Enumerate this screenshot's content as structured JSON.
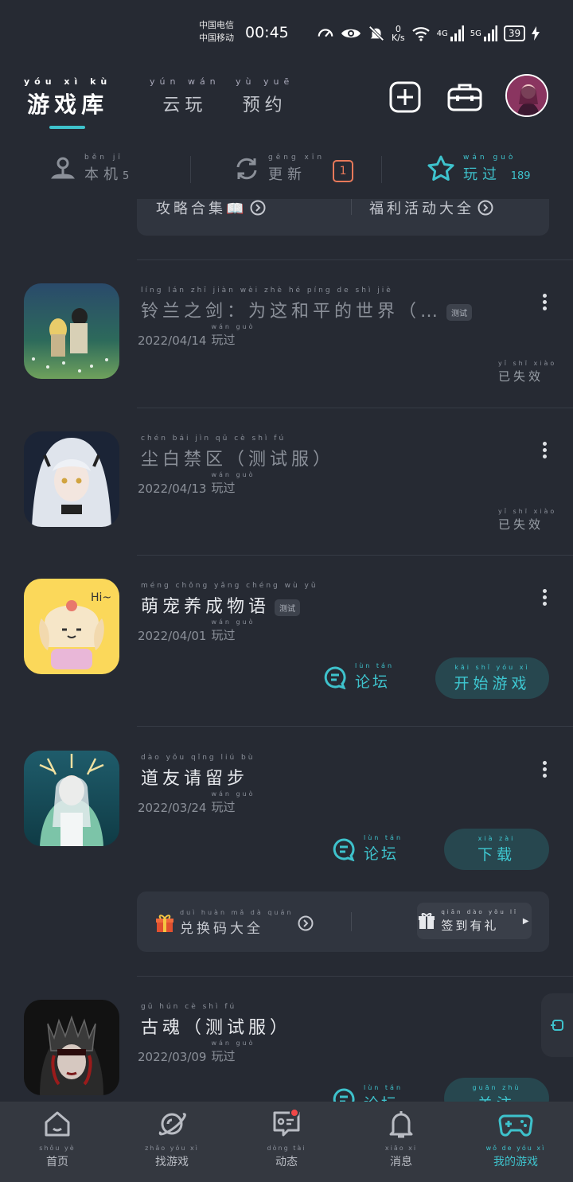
{
  "status_bar": {
    "carrier_1": "中国电信",
    "carrier_2": "中国移动",
    "time": "00:45",
    "speed_value": "0",
    "speed_unit": "K/s",
    "network_1": "4G",
    "network_2": "5G",
    "battery": "39"
  },
  "header": {
    "tabs": [
      {
        "pinyin": "yóu xì kù",
        "label": "游戏库",
        "active": true
      },
      {
        "pinyin": "yún wán",
        "label": "云玩",
        "active": false
      },
      {
        "pinyin": "yù yuē",
        "label": "预约",
        "active": false
      }
    ]
  },
  "subtabs": {
    "local": {
      "pinyin": "běn jī",
      "label": "本机",
      "count": "5"
    },
    "update": {
      "pinyin": "gēng xīn",
      "label": "更新",
      "count": "1"
    },
    "played": {
      "pinyin": "wán guò",
      "label": "玩过",
      "count": "189"
    }
  },
  "top_bar": {
    "left": "攻略合集📖",
    "right": "福利活动大全"
  },
  "games": [
    {
      "title": "铃兰之剑：为这和平的世界（…",
      "title_pinyin": "líng lán zhī jiàn   wèi zhè hé píng de shì jiè",
      "tag": "测试",
      "date": "2022/04/14",
      "played_pinyin": "wán guò",
      "played": "玩过",
      "status_pinyin": "yǐ shī xiào",
      "status": "已失效"
    },
    {
      "title": "尘白禁区（测试服）",
      "title_pinyin": "chén bái jìn qū   cè shì fú",
      "date": "2022/04/13",
      "played_pinyin": "wán guò",
      "played": "玩过",
      "status_pinyin": "yǐ shī xiào",
      "status": "已失效"
    },
    {
      "title": "萌宠养成物语",
      "title_pinyin": "méng chǒng yǎng chéng wù yǔ",
      "tag": "测试",
      "date": "2022/04/01",
      "played_pinyin": "wán guò",
      "played": "玩过",
      "forum_pinyin": "lùn tán",
      "forum": "论坛",
      "action_pinyin": "kāi shǐ yóu xì",
      "action": "开始游戏"
    },
    {
      "title": "道友请留步",
      "title_pinyin": "dào yǒu qǐng liú bù",
      "date": "2022/03/24",
      "played_pinyin": "wán guò",
      "played": "玩过",
      "forum_pinyin": "lùn tán",
      "forum": "论坛",
      "action_pinyin": "xià zài",
      "action": "下载"
    },
    {
      "title": "古魂（测试服）",
      "title_pinyin": "gǔ hún   cè shì fú",
      "date": "2022/03/09",
      "played_pinyin": "wán guò",
      "played": "玩过",
      "forum_pinyin": "lùn tán",
      "forum": "论坛",
      "action_pinyin": "guān zhù",
      "action": "关注"
    }
  ],
  "promo_bar": {
    "left_pinyin": "duì huàn mǎ dà quán",
    "left": "兑换码大全",
    "right_pinyin": "qiān dào yǒu lǐ",
    "right": "签到有礼"
  },
  "bottom_nav": [
    {
      "pinyin": "shǒu yè",
      "label": "首页",
      "icon": "home-icon"
    },
    {
      "pinyin": "zhǎo yóu xì",
      "label": "找游戏",
      "icon": "planet-icon"
    },
    {
      "pinyin": "dòng tài",
      "label": "动态",
      "icon": "feed-icon"
    },
    {
      "pinyin": "xiāo xi",
      "label": "消息",
      "icon": "bell-icon"
    },
    {
      "pinyin": "wǒ de yóu xì",
      "label": "我的游戏",
      "icon": "gamepad-icon",
      "active": true
    }
  ],
  "colors": {
    "accent": "#3ec2cc",
    "background": "#262a33",
    "update_badge": "#e8795a"
  }
}
